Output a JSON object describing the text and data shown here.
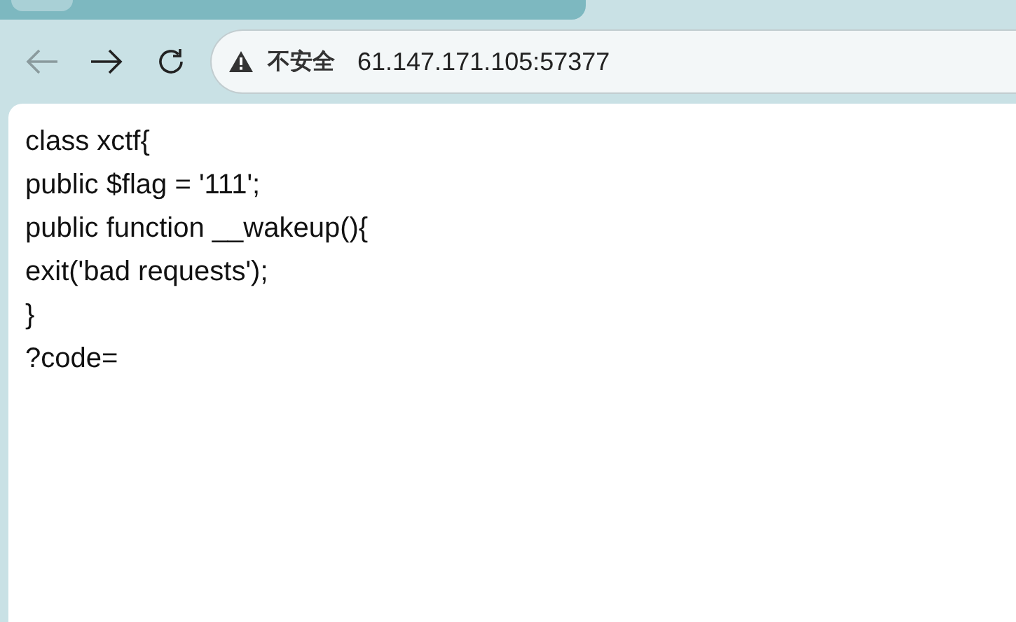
{
  "toolbar": {
    "back": {
      "disabled": true
    },
    "forward": {
      "disabled": false
    }
  },
  "address_bar": {
    "security_label": "不安全",
    "url": "61.147.171.105:57377"
  },
  "page": {
    "lines": [
      "class xctf{",
      "public $flag = '111';",
      "public function __wakeup(){",
      "exit('bad requests');",
      "}",
      "?code="
    ]
  }
}
